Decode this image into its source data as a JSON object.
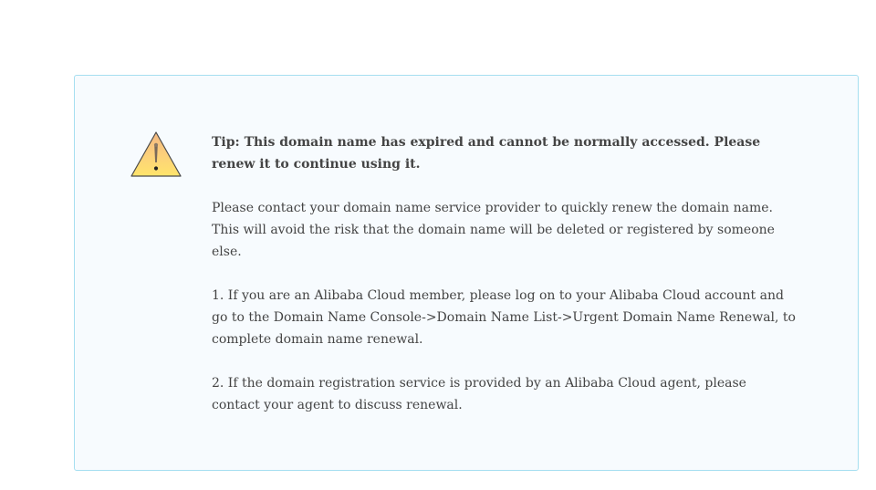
{
  "notice": {
    "icon": "warning-triangle-icon",
    "tip": "Tip: This domain name has expired and cannot be normally accessed. Please renew it to continue using it.",
    "paragraphs": [
      "Please contact your domain name service provider to quickly renew the domain name. This will avoid the risk that the domain name will be deleted or registered by someone else.",
      "1. If you are an Alibaba Cloud member, please log on to your Alibaba Cloud account and go to the Domain Name Console->Domain Name List->Urgent Domain Name Renewal, to complete domain name renewal.",
      "2. If the domain registration service is provided by an Alibaba Cloud agent, please contact your agent to discuss renewal."
    ]
  },
  "colors": {
    "panel_background": "#f7fbfe",
    "panel_border": "#a6dff0",
    "text": "#444444",
    "warning_fill": "#fdd56a",
    "warning_edge": "#4a4a4a"
  }
}
